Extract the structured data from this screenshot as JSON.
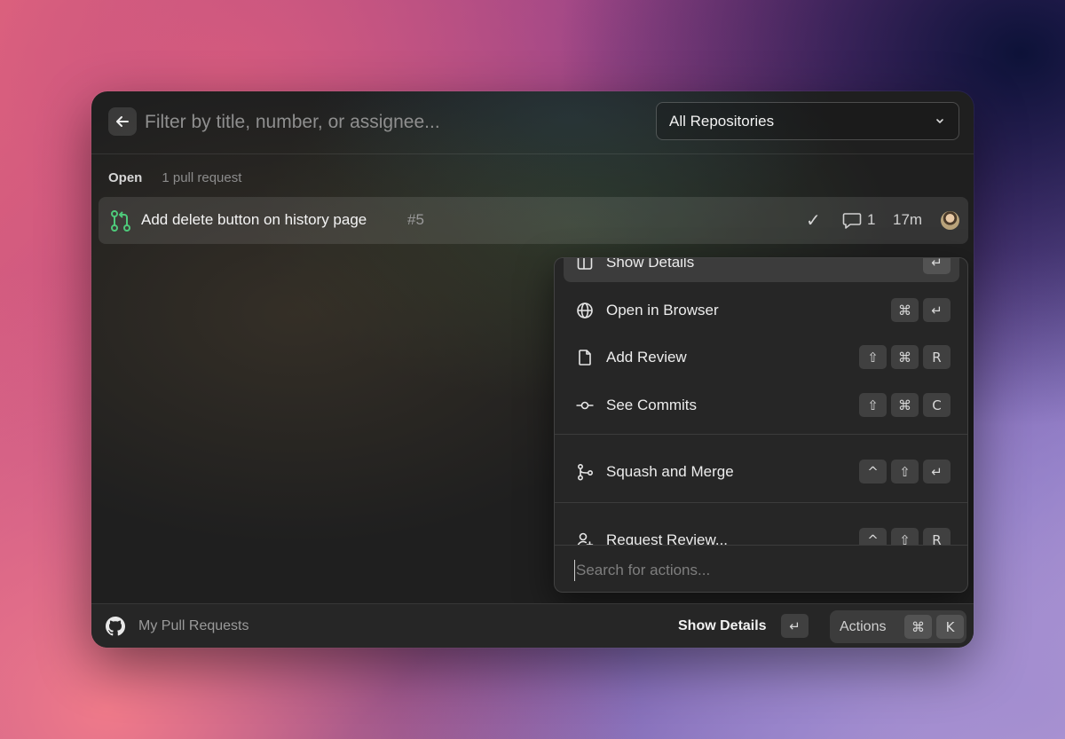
{
  "search": {
    "placeholder": "Filter by title, number, or assignee..."
  },
  "repository_filter": {
    "selected": "All Repositories"
  },
  "section": {
    "title": "Open",
    "count": "1 pull request"
  },
  "pull_request": {
    "title": "Add delete button on history page",
    "number": "#5",
    "status": "✓",
    "comment_count": "1",
    "age": "17m"
  },
  "action_menu": {
    "items": [
      {
        "label": "Show Details",
        "icon": "sidebar-icon",
        "shortcut": [
          "↵"
        ]
      },
      {
        "label": "Open in Browser",
        "icon": "globe-icon",
        "shortcut": [
          "⌘",
          "↵"
        ]
      },
      {
        "label": "Add Review",
        "icon": "document-icon",
        "shortcut": [
          "⇧",
          "⌘",
          "R"
        ]
      },
      {
        "label": "See Commits",
        "icon": "commit-icon",
        "shortcut": [
          "⇧",
          "⌘",
          "C"
        ]
      },
      {
        "label": "Squash and Merge",
        "icon": "merge-icon",
        "shortcut": [
          "^",
          "⇧",
          "↵"
        ]
      },
      {
        "label": "Request Review...",
        "icon": "user-plus-icon",
        "shortcut": [
          "^",
          "⇧",
          "R"
        ]
      }
    ],
    "search_placeholder": "Search for actions..."
  },
  "footer": {
    "title": "My Pull Requests",
    "primary_action": "Show Details",
    "primary_key": "↵",
    "actions_label": "Actions",
    "actions_keys": [
      "⌘",
      "K"
    ]
  },
  "colors": {
    "window_bg": "#1f1f1f",
    "menu_bg": "#262626",
    "pr_icon": "#4ec97a"
  }
}
